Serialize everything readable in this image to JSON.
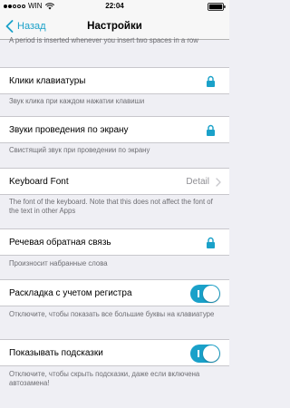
{
  "status_bar": {
    "carrier": "WIN",
    "time": "22:04"
  },
  "nav": {
    "back_label": "Назад",
    "title": "Настройки"
  },
  "top_footer": "A period is inserted whenever you insert two spaces in a row",
  "rows": [
    {
      "label": "Клики клавиатуры",
      "accessory": "lock-icon",
      "footer": "Звук клика при каждом нажатии клавиши"
    },
    {
      "label": "Звуки проведения по экрану",
      "accessory": "lock-icon",
      "footer": "Свистящий звук при проведении по экрану"
    },
    {
      "label": "Keyboard Font",
      "detail": "Detail",
      "accessory": "chevron-right-icon",
      "footer": "The font of the keyboard. Note that this does not affect the font of the text in other Apps"
    },
    {
      "label": "Речевая обратная связь",
      "accessory": "lock-icon",
      "footer": "Произносит набранные слова"
    },
    {
      "label": "Раскладка с учетом регистра",
      "accessory": "toggle",
      "toggle_on": true,
      "footer": "Отключите, чтобы показать все большие буквы на клавиатуре"
    },
    {
      "label": "Показывать подсказки",
      "accessory": "toggle",
      "toggle_on": true,
      "footer": "Отключите, чтобы скрыть подсказки, даже если включена автозамена!"
    }
  ],
  "colors": {
    "accent": "#1aa1c9",
    "background": "#efeff4",
    "footer_text": "#6d6d72",
    "detail_text": "#8e8e93"
  }
}
